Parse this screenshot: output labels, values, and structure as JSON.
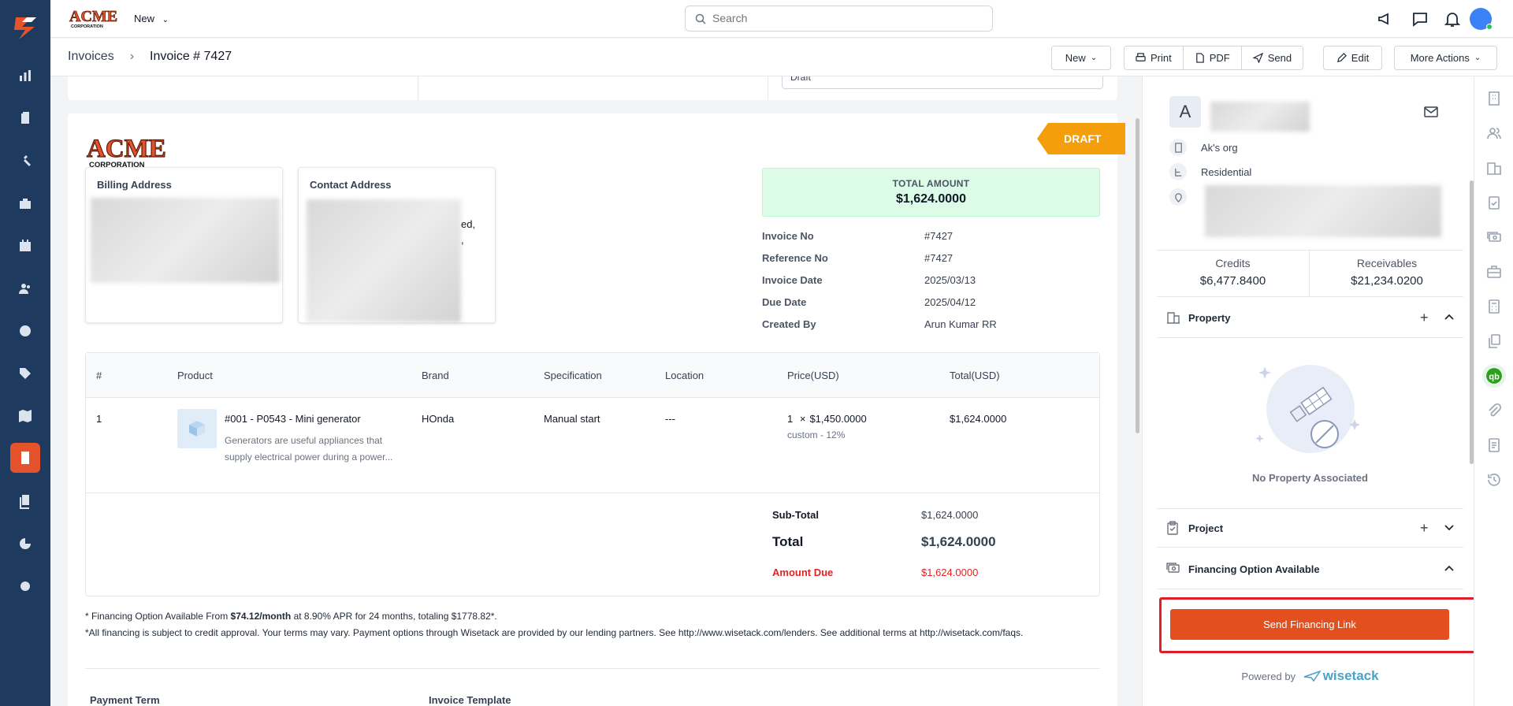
{
  "topbar": {
    "logo_text": "ACME",
    "logo_sub": "CORPORATION",
    "new_label": "New",
    "search_placeholder": "Search"
  },
  "subheader": {
    "breadcrumb_root": "Invoices",
    "breadcrumb_current": "Invoice # 7427",
    "new_label": "New",
    "print_label": "Print",
    "pdf_label": "PDF",
    "send_label": "Send",
    "edit_label": "Edit",
    "more_label": "More Actions"
  },
  "top_card": {
    "status_value": "Draft"
  },
  "invoice": {
    "ribbon": "DRAFT",
    "billing_label": "Billing Address",
    "contact_label": "Contact Address",
    "contact_fragment_1": "ed,",
    "contact_fragment_2": ",",
    "total_label": "TOTAL AMOUNT",
    "total_value": "$1,624.0000",
    "meta": [
      {
        "k": "Invoice No",
        "v": "#7427"
      },
      {
        "k": "Reference No",
        "v": "#7427"
      },
      {
        "k": "Invoice Date",
        "v": "2025/03/13"
      },
      {
        "k": "Due Date",
        "v": "2025/04/12"
      },
      {
        "k": "Created By",
        "v": "Arun Kumar RR"
      }
    ],
    "columns": [
      "#",
      "Product",
      "Brand",
      "Specification",
      "Location",
      "Price(USD)",
      "Total(USD)"
    ],
    "row": {
      "num": "1",
      "product": "#001 - P0543 - Mini generator",
      "desc_1": "Generators are useful appliances that",
      "desc_2": "supply electrical power during a power...",
      "brand": "HOnda",
      "spec": "Manual start",
      "location": "---",
      "qty": "1",
      "times": "×",
      "price": "$1,450.0000",
      "price_note": "custom - 12%",
      "total": "$1,624.0000"
    },
    "subtotal_label": "Sub-Total",
    "subtotal_value": "$1,624.0000",
    "grand_label": "Total",
    "grand_value": "$1,624.0000",
    "due_label": "Amount Due",
    "due_value": "$1,624.0000",
    "fin_note_prefix": "* Financing Option Available From ",
    "fin_note_monthly": "$74.12/month",
    "fin_note_suffix": " at 8.90% APR for 24 months, totaling $1778.82*.",
    "fin_note_line2": "*All financing is subject to credit approval. Your terms may vary. Payment options through Wisetack are provided by our lending partners. See http://www.wisetack.com/lenders. See additional terms at http://wisetack.com/faqs.",
    "payment_term_label": "Payment Term",
    "template_label": "Invoice Template"
  },
  "right_panel": {
    "avatar_letter": "A",
    "org": "Ak's org",
    "type": "Residential",
    "credits_label": "Credits",
    "credits_value": "$6,477.8400",
    "receivables_label": "Receivables",
    "receivables_value": "$21,234.0200",
    "property_label": "Property",
    "no_property": "No Property Associated",
    "project_label": "Project",
    "financing_label": "Financing Option Available",
    "financing_button": "Send Financing Link",
    "powered_by": "Powered by",
    "powered_brand": "wisetack"
  },
  "colors": {
    "nav_bg": "#1e3a5f",
    "accent": "#e4532b",
    "draft_ribbon": "#f59e0b",
    "total_bg": "#dcfce7",
    "amount_due": "#dc2626",
    "highlight_border": "#e11d2a"
  }
}
